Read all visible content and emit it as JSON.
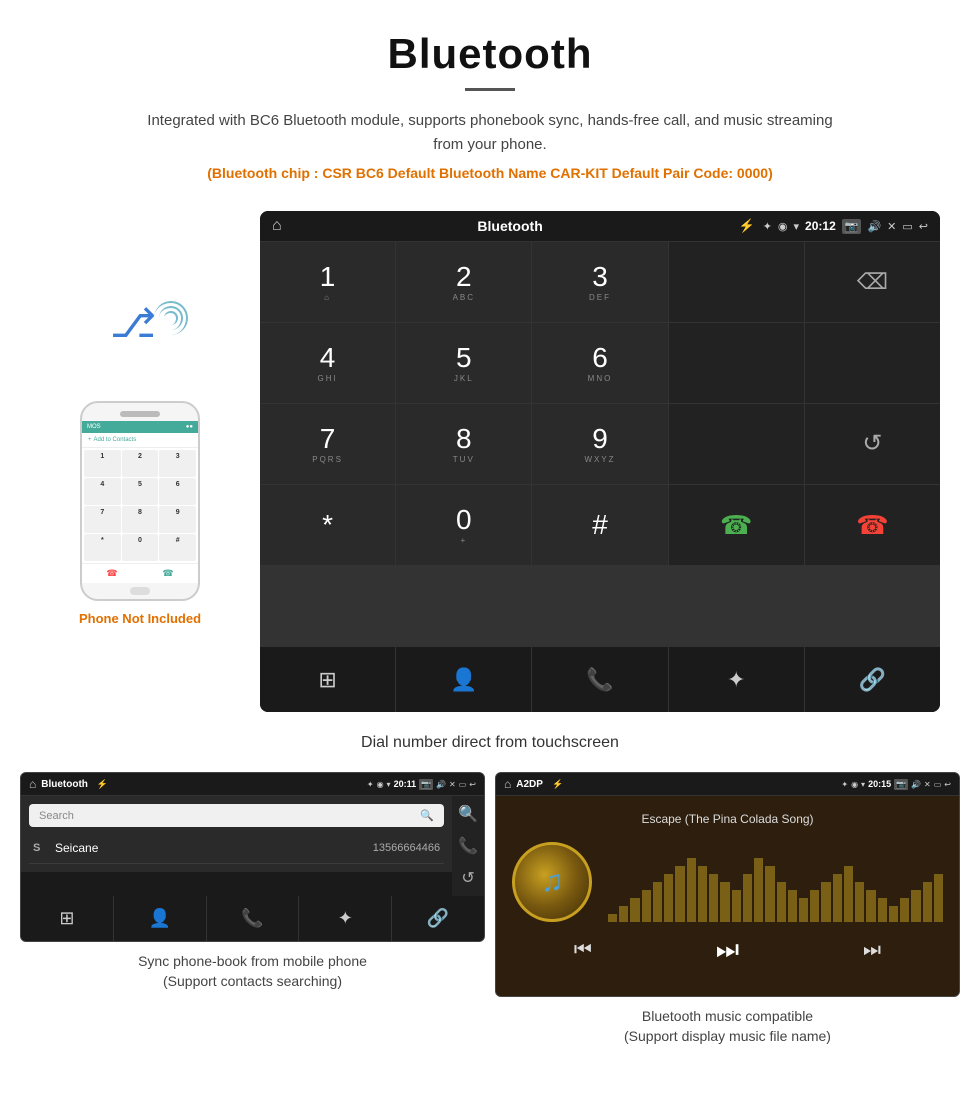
{
  "page": {
    "title": "Bluetooth",
    "divider": true,
    "description": "Integrated with BC6 Bluetooth module, supports phonebook sync, hands-free call, and music streaming from your phone.",
    "specs": "(Bluetooth chip : CSR BC6    Default Bluetooth Name CAR-KIT    Default Pair Code: 0000)",
    "phone_not_included": "Phone Not Included",
    "main_caption": "Dial number direct from touchscreen",
    "bottom_left_caption": "Sync phone-book from mobile phone\n(Support contacts searching)",
    "bottom_right_caption": "Bluetooth music compatible\n(Support display music file name)"
  },
  "car_display": {
    "status_bar": {
      "title": "Bluetooth",
      "time": "20:12",
      "usb_icon": "⚡",
      "bt_icon": "✦",
      "location_icon": "◉",
      "signal_icon": "▾",
      "camera_icon": "📷",
      "volume_icon": "🔊",
      "close_icon": "✕",
      "window_icon": "▭",
      "back_icon": "↩"
    },
    "dialpad": {
      "keys": [
        {
          "num": "1",
          "sub": "⌂"
        },
        {
          "num": "2",
          "sub": "ABC"
        },
        {
          "num": "3",
          "sub": "DEF"
        },
        {
          "num": "",
          "sub": ""
        },
        {
          "num": "⌫",
          "sub": ""
        },
        {
          "num": "4",
          "sub": "GHI"
        },
        {
          "num": "5",
          "sub": "JKL"
        },
        {
          "num": "6",
          "sub": "MNO"
        },
        {
          "num": "",
          "sub": ""
        },
        {
          "num": "",
          "sub": ""
        },
        {
          "num": "7",
          "sub": "PQRS"
        },
        {
          "num": "8",
          "sub": "TUV"
        },
        {
          "num": "9",
          "sub": "WXYZ"
        },
        {
          "num": "",
          "sub": ""
        },
        {
          "num": "↺",
          "sub": ""
        },
        {
          "num": "*",
          "sub": ""
        },
        {
          "num": "0",
          "sub": "+"
        },
        {
          "num": "#",
          "sub": ""
        },
        {
          "num": "📞",
          "sub": ""
        },
        {
          "num": "📵",
          "sub": ""
        }
      ],
      "bottom_buttons": [
        "⊞",
        "👤",
        "📞",
        "✦",
        "🔗"
      ]
    }
  },
  "phonebook_display": {
    "status_bar": {
      "title": "Bluetooth",
      "time": "20:11"
    },
    "search_placeholder": "Search",
    "contacts": [
      {
        "letter": "S",
        "name": "Seicane",
        "number": "13566664466"
      }
    ],
    "side_icons": [
      "🔍",
      "📞",
      "↺"
    ],
    "bottom_buttons": [
      "⊞",
      "👤",
      "📞",
      "✦",
      "🔗"
    ]
  },
  "music_display": {
    "status_bar": {
      "title": "A2DP",
      "time": "20:15"
    },
    "song_title": "Escape (The Pina Colada Song)",
    "controls": {
      "prev": "⏮",
      "play_pause": "⏭",
      "next": "⏭"
    },
    "viz_bars": [
      2,
      4,
      6,
      8,
      10,
      12,
      14,
      16,
      14,
      12,
      10,
      8,
      12,
      16,
      14,
      10,
      8,
      6,
      8,
      10,
      12,
      14,
      10,
      8,
      6,
      4,
      6,
      8,
      10,
      12
    ]
  }
}
